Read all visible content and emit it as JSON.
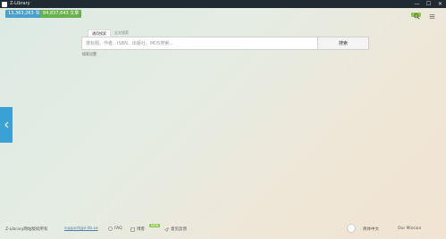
{
  "window": {
    "title": "Z-Library",
    "controls": [
      "—",
      "☐",
      "✕"
    ]
  },
  "badges": {
    "books": "13,363,263 书",
    "articles": "84,837,643 文章"
  },
  "tabs": [
    {
      "label": "通用搜索"
    },
    {
      "label": "全文搜索"
    }
  ],
  "search": {
    "placeholder": "按标题、作者、ISBN、出版社、MD5搜索...",
    "button": "搜索",
    "settings_link": "搜索设置"
  },
  "footer": {
    "copyright": "Z-Library网站版权所有",
    "email": "support@z-lib.se",
    "faq": "FAQ",
    "blog": "博客",
    "new_tag": "NEW",
    "feedback": "意见反馈",
    "language": "简体中文",
    "donate": "Our Mission"
  },
  "colors": {
    "accent": "#3ba0d4",
    "books_badge": "#4aa0c8",
    "articles_badge": "#6bb04e",
    "titlebar": "#1f2a33"
  }
}
